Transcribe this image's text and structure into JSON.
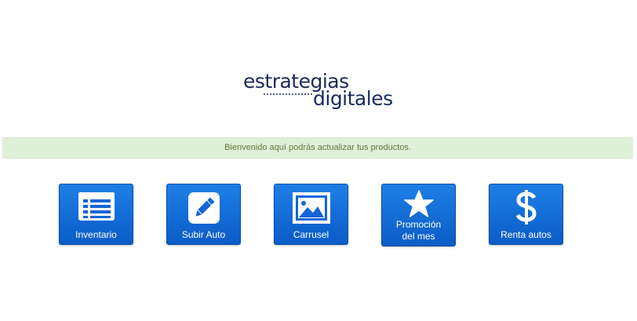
{
  "logo": {
    "line1": "estrategias",
    "line2": "digitales"
  },
  "banner": {
    "message": "Bienvenido aquí podrás actualizar tus productos."
  },
  "tiles": [
    {
      "label": "Inventario",
      "icon": "list-icon"
    },
    {
      "label": "Subir Auto",
      "icon": "pencil-icon"
    },
    {
      "label": "Carrusel",
      "icon": "picture-icon"
    },
    {
      "label_line1": "Promoción",
      "label_line2": "del mes",
      "icon": "star-icon"
    },
    {
      "label": "Renta autos",
      "icon": "dollar-icon"
    }
  ],
  "colors": {
    "tile": "#0b64d4",
    "banner_bg": "#dff0d8",
    "banner_text": "#5b7a3c",
    "logo": "#172a5e"
  }
}
